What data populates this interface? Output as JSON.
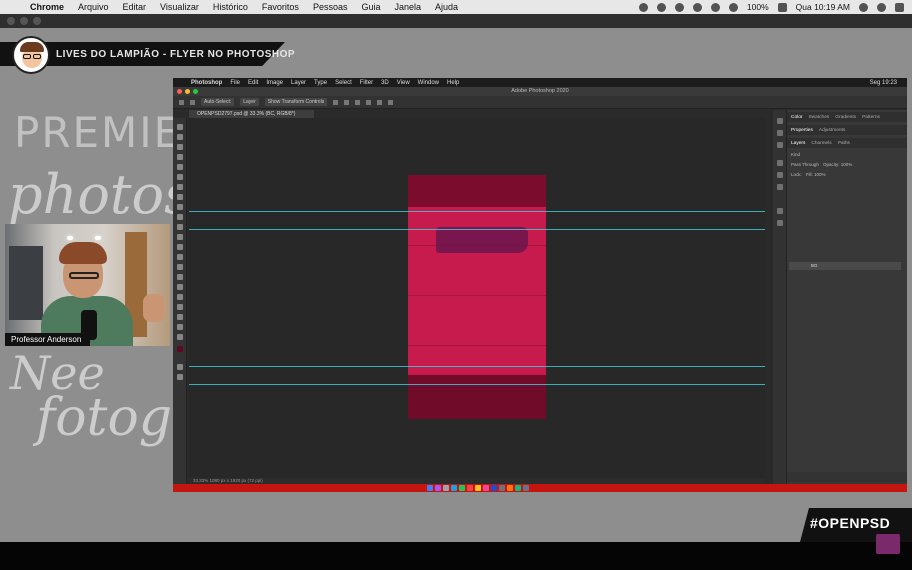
{
  "menubar": {
    "items": [
      "Chrome",
      "Arquivo",
      "Editar",
      "Visualizar",
      "Histórico",
      "Favoritos",
      "Pessoas",
      "Guia",
      "Janela",
      "Ajuda"
    ],
    "battery": "100%",
    "clock": "Qua 10:19 AM"
  },
  "overlay": {
    "title": "LIVES DO LAMPIÃO - FLYER NO PHOTOSHOP",
    "presenter": "Professor Anderson",
    "brand": "#OPENPSD",
    "watermark_lines": [
      "PREMIERE",
      "photoshop",
      "Nee",
      "fotogr"
    ]
  },
  "photoshop": {
    "menu": [
      "Photoshop",
      "File",
      "Edit",
      "Image",
      "Layer",
      "Type",
      "Select",
      "Filter",
      "3D",
      "View",
      "Window",
      "Help"
    ],
    "clock": "Seg 19:23",
    "window_title": "Adobe Photoshop 2020",
    "options": [
      "Auto-Select:",
      "Layer",
      "Show Transform Controls"
    ],
    "doc_tab": "OPENPSD2797.psd @ 33.3% (BC, RGB/8*)",
    "status": "33,33%     1080 px x 1920 px (72 ppi)",
    "panel_tabs_top": [
      "Color",
      "Swatches",
      "Gradients",
      "Patterns"
    ],
    "panel_tabs_mid": [
      "Properties",
      "Adjustments"
    ],
    "panel_tabs_layers": [
      "Layers",
      "Channels",
      "Paths"
    ],
    "layer_kind": "Kind",
    "blend_mode": "Pass Through",
    "opacity": "Opacity: 100%",
    "fill": "Fill: 100%",
    "lock": "Lock:",
    "layer_name": "BG"
  },
  "colors": {
    "accent_red": "#c4160f",
    "artboard": "#c81b4d",
    "guide": "#3ec6d6"
  }
}
